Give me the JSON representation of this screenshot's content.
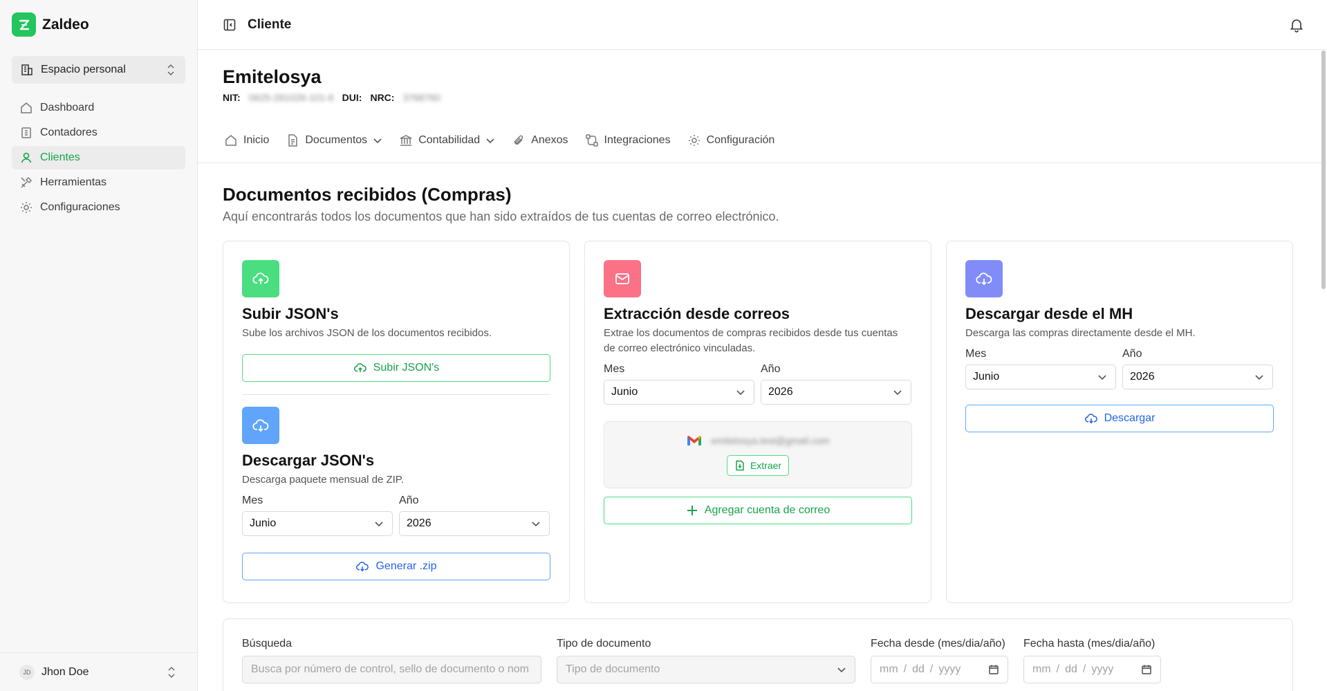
{
  "app": {
    "name": "Zaldeo"
  },
  "sidebar": {
    "workspace": "Espacio personal",
    "items": [
      {
        "label": "Dashboard",
        "icon": "home-icon"
      },
      {
        "label": "Contadores",
        "icon": "building-icon"
      },
      {
        "label": "Clientes",
        "icon": "user-icon",
        "active": true
      },
      {
        "label": "Herramientas",
        "icon": "tools-icon"
      },
      {
        "label": "Configuraciones",
        "icon": "gear-icon"
      }
    ],
    "user": {
      "initials": "JD",
      "name": "Jhon Doe"
    }
  },
  "topbar": {
    "title": "Cliente"
  },
  "client": {
    "name": "Emitelosya",
    "nit_label": "NIT:",
    "nit_value": "0625-281026-101-6",
    "dui_label": "DUI:",
    "nrc_label": "NRC:",
    "nrc_value": "3768760"
  },
  "tabs": [
    {
      "label": "Inicio",
      "icon": "home-icon"
    },
    {
      "label": "Documentos",
      "icon": "document-icon",
      "dropdown": true
    },
    {
      "label": "Contabilidad",
      "icon": "bank-icon",
      "dropdown": true
    },
    {
      "label": "Anexos",
      "icon": "paperclip-icon"
    },
    {
      "label": "Integraciones",
      "icon": "integrations-icon"
    },
    {
      "label": "Configuración",
      "icon": "gear-icon"
    }
  ],
  "page": {
    "title": "Documentos recibidos (Compras)",
    "subtitle": "Aquí encontrarás todos los documentos que han sido extraídos de tus cuentas de correo electrónico."
  },
  "cards": {
    "upload": {
      "title": "Subir JSON's",
      "description": "Sube los archivos JSON de los documentos recibidos.",
      "button": "Subir JSON's",
      "color": "#4ade80"
    },
    "download_json": {
      "title": "Descargar JSON's",
      "description": "Descarga paquete mensual de ZIP.",
      "month_label": "Mes",
      "month_value": "Junio",
      "year_label": "Año",
      "year_value": "2026",
      "button": "Generar .zip",
      "color": "#60a5fa"
    },
    "email": {
      "title": "Extracción desde correos",
      "description": "Extrae los documentos de compras recibidos desde tus cuentas de correo electrónico vinculadas.",
      "month_label": "Mes",
      "month_value": "Junio",
      "year_label": "Año",
      "year_value": "2026",
      "account": "emitelosya.test@gmail.com",
      "extract_button": "Extraer",
      "add_button": "Agregar cuenta de correo",
      "color": "#fb7185"
    },
    "mh": {
      "title": "Descargar desde el MH",
      "description": "Descarga las compras directamente desde el MH.",
      "month_label": "Mes",
      "month_value": "Junio",
      "year_label": "Año",
      "year_value": "2026",
      "button": "Descargar",
      "color": "#818cf8"
    }
  },
  "filters": {
    "search_label": "Búsqueda",
    "search_placeholder": "Busca por número de control, sello de documento o nom",
    "type_label": "Tipo de documento",
    "type_placeholder": "Tipo de documento",
    "from_label": "Fecha desde (mes/dia/año)",
    "to_label": "Fecha hasta (mes/dia/año)",
    "date_mm": "mm",
    "date_dd": "dd",
    "date_yyyy": "yyyy",
    "date_sep": "/"
  }
}
